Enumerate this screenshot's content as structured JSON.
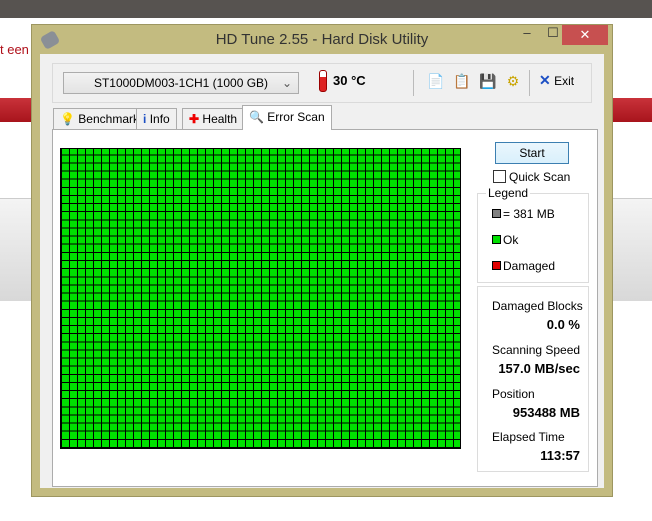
{
  "background": {
    "partial_text": "t een"
  },
  "window": {
    "title": "HD Tune 2.55 - Hard Disk Utility",
    "minimize": "‒",
    "maximize": "☐",
    "close": "✕"
  },
  "toolbar": {
    "drive": "ST1000DM003-1CH1 (1000 GB)",
    "temperature": "30 °C",
    "exit_label": "Exit"
  },
  "tabs": [
    {
      "label": "Benchmark",
      "icon": "bulb-icon"
    },
    {
      "label": "Info",
      "icon": "info-icon"
    },
    {
      "label": "Health",
      "icon": "health-cross-icon"
    },
    {
      "label": "Error Scan",
      "icon": "magnifier-icon"
    }
  ],
  "scan": {
    "start_label": "Start",
    "quick_scan_label": "Quick Scan",
    "quick_scan_checked": false
  },
  "legend": {
    "title": "Legend",
    "block": "= 381 MB",
    "ok": "Ok",
    "damaged": "Damaged",
    "colors": {
      "block": "#808080",
      "ok": "#00e000",
      "damaged": "#e00000"
    }
  },
  "stats": [
    {
      "label": "Damaged Blocks",
      "value": "0.0 %"
    },
    {
      "label": "Scanning Speed",
      "value": "157.0 MB/sec"
    },
    {
      "label": "Position",
      "value": "953488 MB"
    },
    {
      "label": "Elapsed Time",
      "value": "113:57"
    }
  ]
}
